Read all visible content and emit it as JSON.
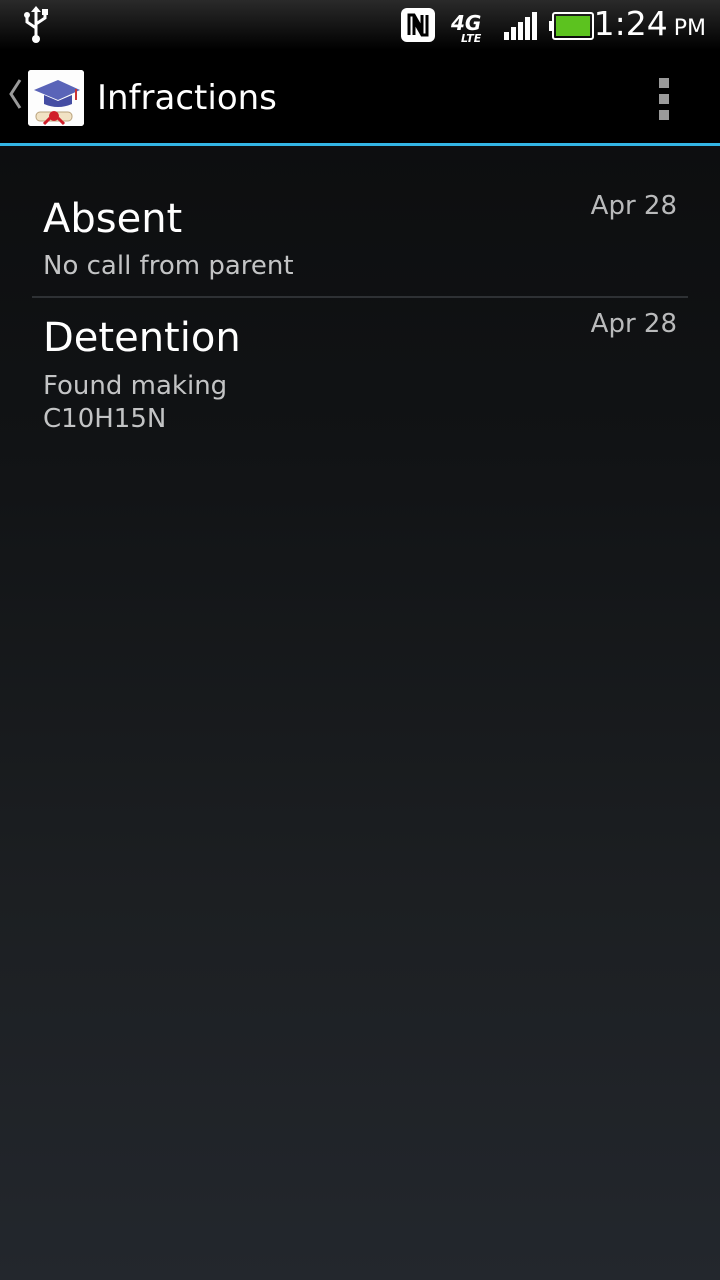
{
  "status_bar": {
    "time": "1:24",
    "ampm": "PM",
    "network": "4G LTE",
    "icons": [
      "usb-icon",
      "nfc-icon",
      "lte-icon",
      "signal-icon",
      "battery-icon"
    ]
  },
  "action_bar": {
    "title": "Infractions",
    "accent_color": "#33b5e5",
    "icons": [
      "up-caret-icon",
      "graduation-app-icon",
      "overflow-menu-icon"
    ]
  },
  "infractions": [
    {
      "title": "Absent",
      "detail": "No call from parent",
      "date": "Apr 28"
    },
    {
      "title": "Detention",
      "detail_lines": [
        "Found making",
        "C10H15N"
      ],
      "date": "Apr 28"
    }
  ]
}
